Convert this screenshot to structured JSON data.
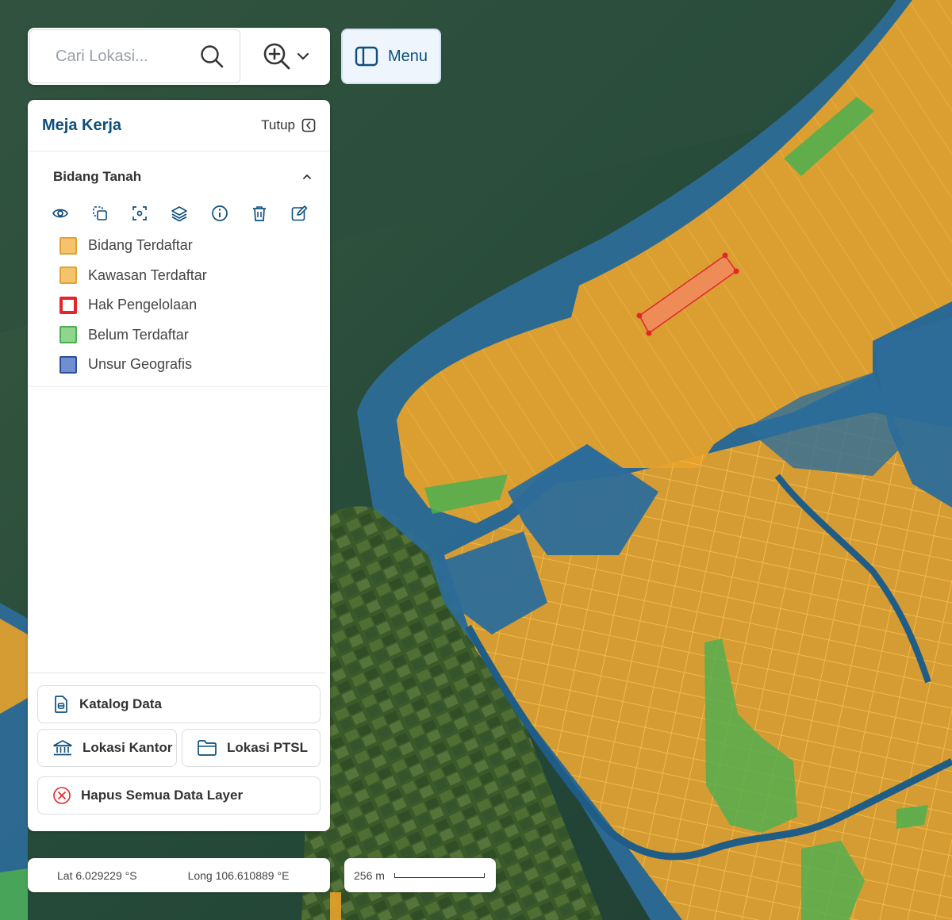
{
  "search": {
    "placeholder": "Cari Lokasi..."
  },
  "menu_button": {
    "label": "Menu"
  },
  "panel": {
    "title": "Meja Kerja",
    "close_label": "Tutup",
    "section_title": "Bidang Tanah",
    "tools": [
      "eye-icon",
      "copy-select-icon",
      "focus-icon",
      "layers-icon",
      "info-icon",
      "trash-icon",
      "edit-icon"
    ],
    "legend": [
      {
        "label": "Bidang Terdaftar",
        "fill": "#f5c36b",
        "border": "#e0a331"
      },
      {
        "label": "Kawasan Terdaftar",
        "fill": "#f5c36b",
        "border": "#e0a331"
      },
      {
        "label": "Hak Pengelolaan",
        "fill": "#ffffff",
        "border": "#e3262b"
      },
      {
        "label": "Belum Terdaftar",
        "fill": "#8fd48f",
        "border": "#4caf50"
      },
      {
        "label": "Unsur Geografis",
        "fill": "#6f8fd0",
        "border": "#2c4f99"
      }
    ],
    "buttons": {
      "katalog": "Katalog Data",
      "kantor": "Lokasi Kantor",
      "ptsl": "Lokasi PTSL",
      "hapus": "Hapus Semua Data Layer"
    }
  },
  "coordinates": {
    "lat": "Lat 6.029229 °S",
    "long": "Long 106.610889 °E"
  },
  "scale": {
    "label": "256 m"
  },
  "colors": {
    "accent": "#0d4f7c",
    "parcel": "#e8a22a",
    "water_feature": "#2d6d9a",
    "unregistered": "#4caf50",
    "highlight": "#f08a5d"
  }
}
